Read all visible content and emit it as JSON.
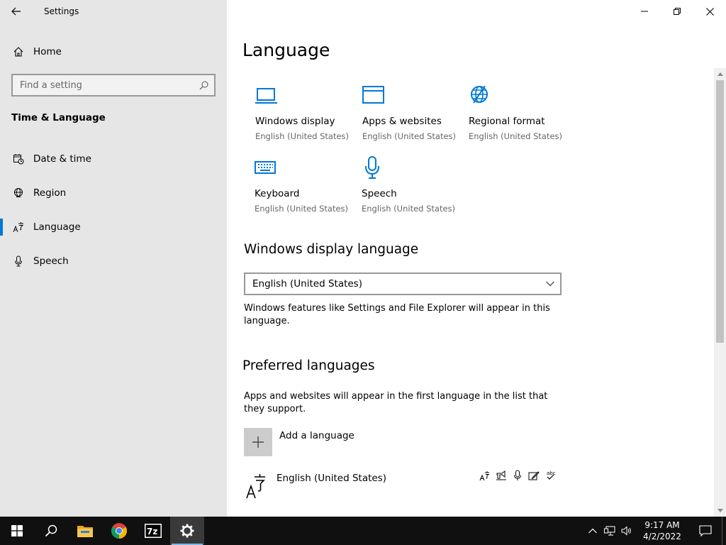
{
  "window": {
    "title": "Settings"
  },
  "sidebar": {
    "home_label": "Home",
    "search_placeholder": "Find a setting",
    "section_title": "Time & Language",
    "items": [
      {
        "label": "Date & time",
        "icon": "calendar-clock-icon"
      },
      {
        "label": "Region",
        "icon": "globe-icon"
      },
      {
        "label": "Language",
        "icon": "language-icon",
        "active": true
      },
      {
        "label": "Speech",
        "icon": "microphone-icon"
      }
    ]
  },
  "main": {
    "title": "Language",
    "tiles": [
      {
        "title": "Windows display",
        "subtitle": "English (United States)",
        "icon": "monitor-icon"
      },
      {
        "title": "Apps & websites",
        "subtitle": "English (United States)",
        "icon": "browser-window-icon"
      },
      {
        "title": "Regional format",
        "subtitle": "English (United States)",
        "icon": "globe-format-icon"
      },
      {
        "title": "Keyboard",
        "subtitle": "English (United States)",
        "icon": "keyboard-icon"
      },
      {
        "title": "Speech",
        "subtitle": "English (United States)",
        "icon": "microphone-icon"
      }
    ],
    "display_language": {
      "heading": "Windows display language",
      "selected": "English (United States)",
      "description": "Windows features like Settings and File Explorer will appear in this language."
    },
    "preferred": {
      "heading": "Preferred languages",
      "description": "Apps and websites will appear in the first language in the list that they support.",
      "add_label": "Add a language",
      "languages": [
        {
          "name": "English (United States)",
          "features": [
            "display-language-icon",
            "text-to-speech-icon",
            "speech-recognition-icon",
            "handwriting-icon",
            "spellcheck-icon"
          ]
        }
      ]
    }
  },
  "taskbar": {
    "time": "9:17 AM",
    "date": "4/2/2022",
    "apps": [
      "file-explorer-icon",
      "chrome-icon",
      "7zip-icon",
      "settings-gear-icon"
    ]
  },
  "colors": {
    "accent": "#0078d7",
    "sidebar_bg": "#e6e6e6",
    "taskbar_bg": "#101010"
  }
}
